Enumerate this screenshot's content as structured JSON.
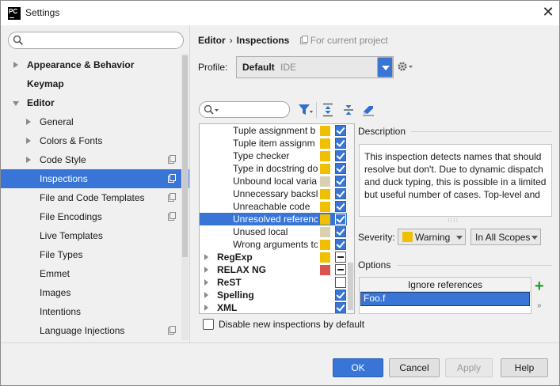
{
  "window": {
    "title": "Settings",
    "app_icon_text": "PC"
  },
  "sidebar": {
    "search_placeholder": "",
    "items": [
      {
        "label": "Appearance & Behavior",
        "bold": true,
        "level": 0,
        "arrow": "right"
      },
      {
        "label": "Keymap",
        "bold": true,
        "level": 0,
        "arrow": "none"
      },
      {
        "label": "Editor",
        "bold": true,
        "level": 0,
        "arrow": "down"
      },
      {
        "label": "General",
        "level": 1,
        "arrow": "right"
      },
      {
        "label": "Colors & Fonts",
        "level": 1,
        "arrow": "right"
      },
      {
        "label": "Code Style",
        "level": 1,
        "arrow": "right",
        "project": true
      },
      {
        "label": "Inspections",
        "level": 1,
        "selected": true,
        "project": true
      },
      {
        "label": "File and Code Templates",
        "level": 1,
        "project": true
      },
      {
        "label": "File Encodings",
        "level": 1,
        "project": true
      },
      {
        "label": "Live Templates",
        "level": 1
      },
      {
        "label": "File Types",
        "level": 1
      },
      {
        "label": "Emmet",
        "level": 1
      },
      {
        "label": "Images",
        "level": 1
      },
      {
        "label": "Intentions",
        "level": 1
      },
      {
        "label": "Language Injections",
        "level": 1,
        "project": true
      }
    ]
  },
  "breadcrumb": {
    "parent": "Editor",
    "separator": "›",
    "current": "Inspections",
    "scope": "For current project"
  },
  "profile": {
    "label": "Profile:",
    "value": "Default",
    "sub": "IDE"
  },
  "inspections": [
    {
      "label": "Tuple assignment b",
      "swatch": "#f0c000",
      "check": "checked"
    },
    {
      "label": "Tuple item assignm",
      "swatch": "#f0c000",
      "check": "checked"
    },
    {
      "label": "Type checker",
      "swatch": "#f0c000",
      "check": "checked"
    },
    {
      "label": "Type in docstring do",
      "swatch": "#f0c000",
      "check": "checked"
    },
    {
      "label": "Unbound local varia",
      "swatch": "#d8d0b0",
      "check": "checked"
    },
    {
      "label": "Unnecessary backsla",
      "swatch": "#f0c000",
      "check": "checked"
    },
    {
      "label": "Unreachable code",
      "swatch": "#f0c000",
      "check": "checked"
    },
    {
      "label": "Unresolved referenc",
      "swatch": "#f0c000",
      "check": "checked",
      "selected": true
    },
    {
      "label": "Unused local",
      "swatch": "#d8d0b0",
      "check": "checked"
    },
    {
      "label": "Wrong arguments to",
      "swatch": "#f0c000",
      "check": "checked"
    },
    {
      "label": "RegExp",
      "group": true,
      "swatch": "#f0c000",
      "check": "mixed"
    },
    {
      "label": "RELAX NG",
      "group": true,
      "swatch": "#d9534f",
      "check": "mixed"
    },
    {
      "label": "ReST",
      "group": true,
      "swatch": "",
      "check": "unchecked"
    },
    {
      "label": "Spelling",
      "group": true,
      "swatch": "",
      "check": "checked"
    },
    {
      "label": "XML",
      "group": true,
      "swatch": "",
      "check": "checked"
    }
  ],
  "disable_new": {
    "label": "Disable new inspections by default"
  },
  "description": {
    "title": "Description",
    "text": "This inspection detects names that should resolve but don't. Due to dynamic dispatch and duck typing, this is possible in a limited but useful number of cases. Top-level and"
  },
  "severity": {
    "label": "Severity:",
    "value": "Warning",
    "color": "#f0c000",
    "scope": "In All Scopes"
  },
  "options": {
    "title": "Options",
    "column_header": "Ignore references",
    "row_value": "Foo.f",
    "add_label": "+",
    "more_label": "»"
  },
  "buttons": {
    "ok": "OK",
    "cancel": "Cancel",
    "apply": "Apply",
    "help": "Help"
  },
  "colors": {
    "accent": "#3875d7",
    "warning": "#f0c000",
    "error": "#d9534f"
  }
}
